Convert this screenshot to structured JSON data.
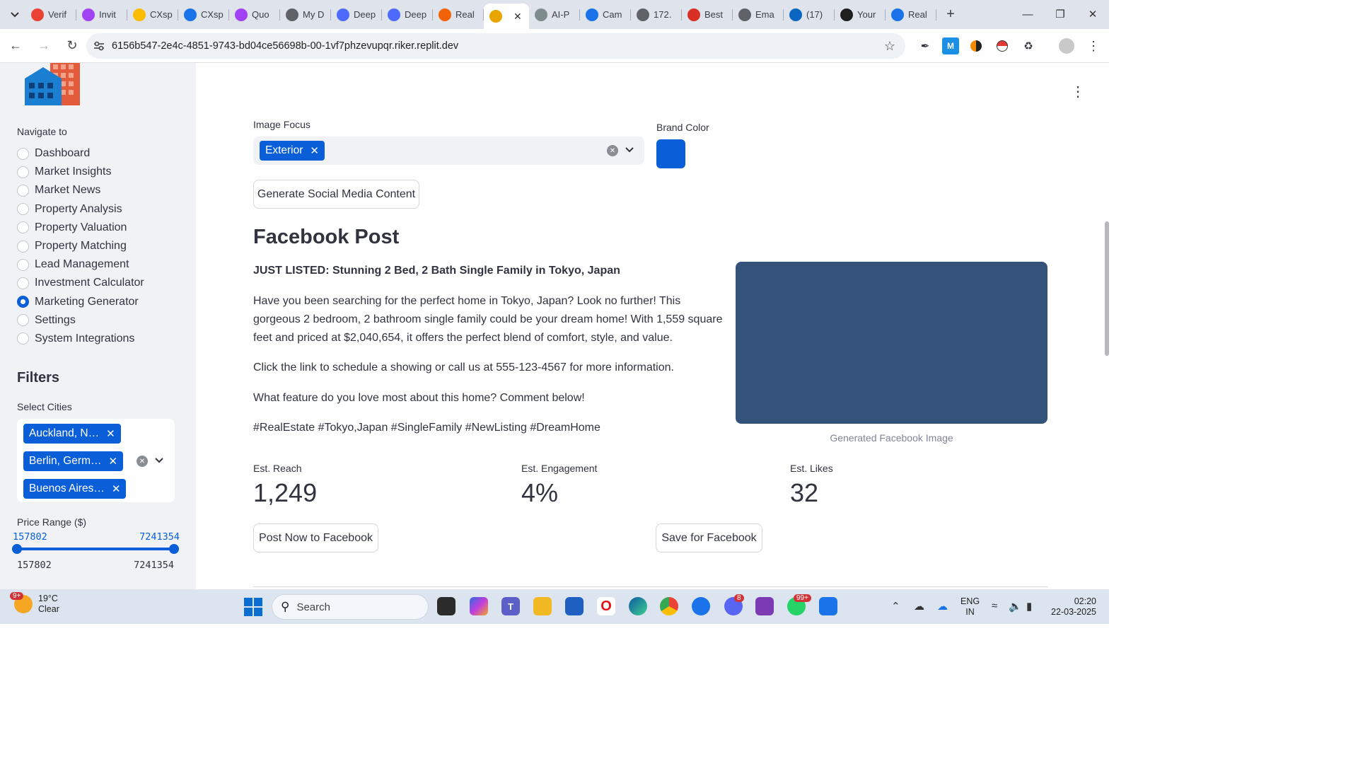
{
  "browser": {
    "tabs": [
      {
        "label": "Verif",
        "icon": "gmail-icon",
        "color": "#ea4335"
      },
      {
        "label": "Invit",
        "icon": "gmail-icon",
        "color": "#a142f4"
      },
      {
        "label": "CXsp",
        "icon": "drive-icon",
        "color": "#fbbc04"
      },
      {
        "label": "CXsp",
        "icon": "calendar-icon",
        "color": "#1a73e8"
      },
      {
        "label": "Quo",
        "icon": "gmail-icon",
        "color": "#a142f4"
      },
      {
        "label": "My D",
        "icon": "site-icon",
        "color": "#5f6368"
      },
      {
        "label": "Deep",
        "icon": "deepseek-icon",
        "color": "#4d6bfe"
      },
      {
        "label": "Deep",
        "icon": "deepseek-icon",
        "color": "#4d6bfe"
      },
      {
        "label": "Real",
        "icon": "replit-icon",
        "color": "#f26207"
      },
      {
        "label": "",
        "icon": "house-icon",
        "color": "#e8a400",
        "active": true
      },
      {
        "label": "AI-P",
        "icon": "house-icon",
        "color": "#7f8c8d"
      },
      {
        "label": "Cam",
        "icon": "canva-icon",
        "color": "#1a73e8"
      },
      {
        "label": "172.",
        "icon": "globe-icon",
        "color": "#5f6368"
      },
      {
        "label": "Best",
        "icon": "indiamart-icon",
        "color": "#d93025"
      },
      {
        "label": "Ema",
        "icon": "site-icon",
        "color": "#5f6368"
      },
      {
        "label": "(17)",
        "icon": "linkedin-icon",
        "color": "#0a66c2"
      },
      {
        "label": "Your",
        "icon": "github-icon",
        "color": "#1f1f1f"
      },
      {
        "label": "Real",
        "icon": "search-icon",
        "color": "#1a73e8"
      }
    ],
    "url": "6156b547-2e4c-4851-9743-bd04ce56698b-00-1vf7phzevupqr.riker.replit.dev"
  },
  "sidebar": {
    "nav_title": "Navigate to",
    "items": [
      {
        "label": "Dashboard",
        "checked": false
      },
      {
        "label": "Market Insights",
        "checked": false
      },
      {
        "label": "Market News",
        "checked": false
      },
      {
        "label": "Property Analysis",
        "checked": false
      },
      {
        "label": "Property Valuation",
        "checked": false
      },
      {
        "label": "Property Matching",
        "checked": false
      },
      {
        "label": "Lead Management",
        "checked": false
      },
      {
        "label": "Investment Calculator",
        "checked": false
      },
      {
        "label": "Marketing Generator",
        "checked": true
      },
      {
        "label": "Settings",
        "checked": false
      },
      {
        "label": "System Integrations",
        "checked": false
      }
    ],
    "filters_title": "Filters",
    "select_cities_label": "Select Cities",
    "cities": [
      "Auckland, N…",
      "Berlin, Germ…",
      "Buenos Aires…"
    ],
    "price_range_label": "Price Range ($)",
    "price_low": "157802",
    "price_high": "7241354",
    "price_min": "157802",
    "price_max": "7241354"
  },
  "main": {
    "image_focus_label": "Image Focus",
    "image_focus_chip": "Exterior",
    "brand_color_label": "Brand Color",
    "brand_color": "#0a5fd8",
    "generate_button": "Generate Social Media Content",
    "section_title": "Facebook Post",
    "post_title": "JUST LISTED: Stunning 2 Bed, 2 Bath Single Family in Tokyo, Japan",
    "post_body": "Have you been searching for the perfect home in Tokyo, Japan? Look no further! This gorgeous 2 bedroom, 2 bathroom single family could be your dream home! With 1,559 square feet and priced at $2,040,654, it offers the perfect blend of comfort, style, and value.",
    "post_cta": "Click the link to schedule a showing or call us at 555-123-4567 for more information.",
    "post_question": "What feature do you love most about this home? Comment below!",
    "post_hashtags": "#RealEstate #Tokyo,Japan #SingleFamily #NewListing #DreamHome",
    "image_caption": "Generated Facebook Image",
    "metrics": [
      {
        "label": "Est. Reach",
        "value": "1,249"
      },
      {
        "label": "Est. Engagement",
        "value": "4%"
      },
      {
        "label": "Est. Likes",
        "value": "32"
      }
    ],
    "post_now_button": "Post Now to Facebook",
    "save_button": "Save for Facebook"
  },
  "taskbar": {
    "weather_temp": "19°C",
    "weather_desc": "Clear",
    "weather_badge": "9+",
    "search_label": "Search",
    "teams_badge": "8",
    "whatsapp_badge": "99+",
    "lang_top": "ENG",
    "lang_bottom": "IN",
    "time": "02:20",
    "date": "22-03-2025"
  }
}
